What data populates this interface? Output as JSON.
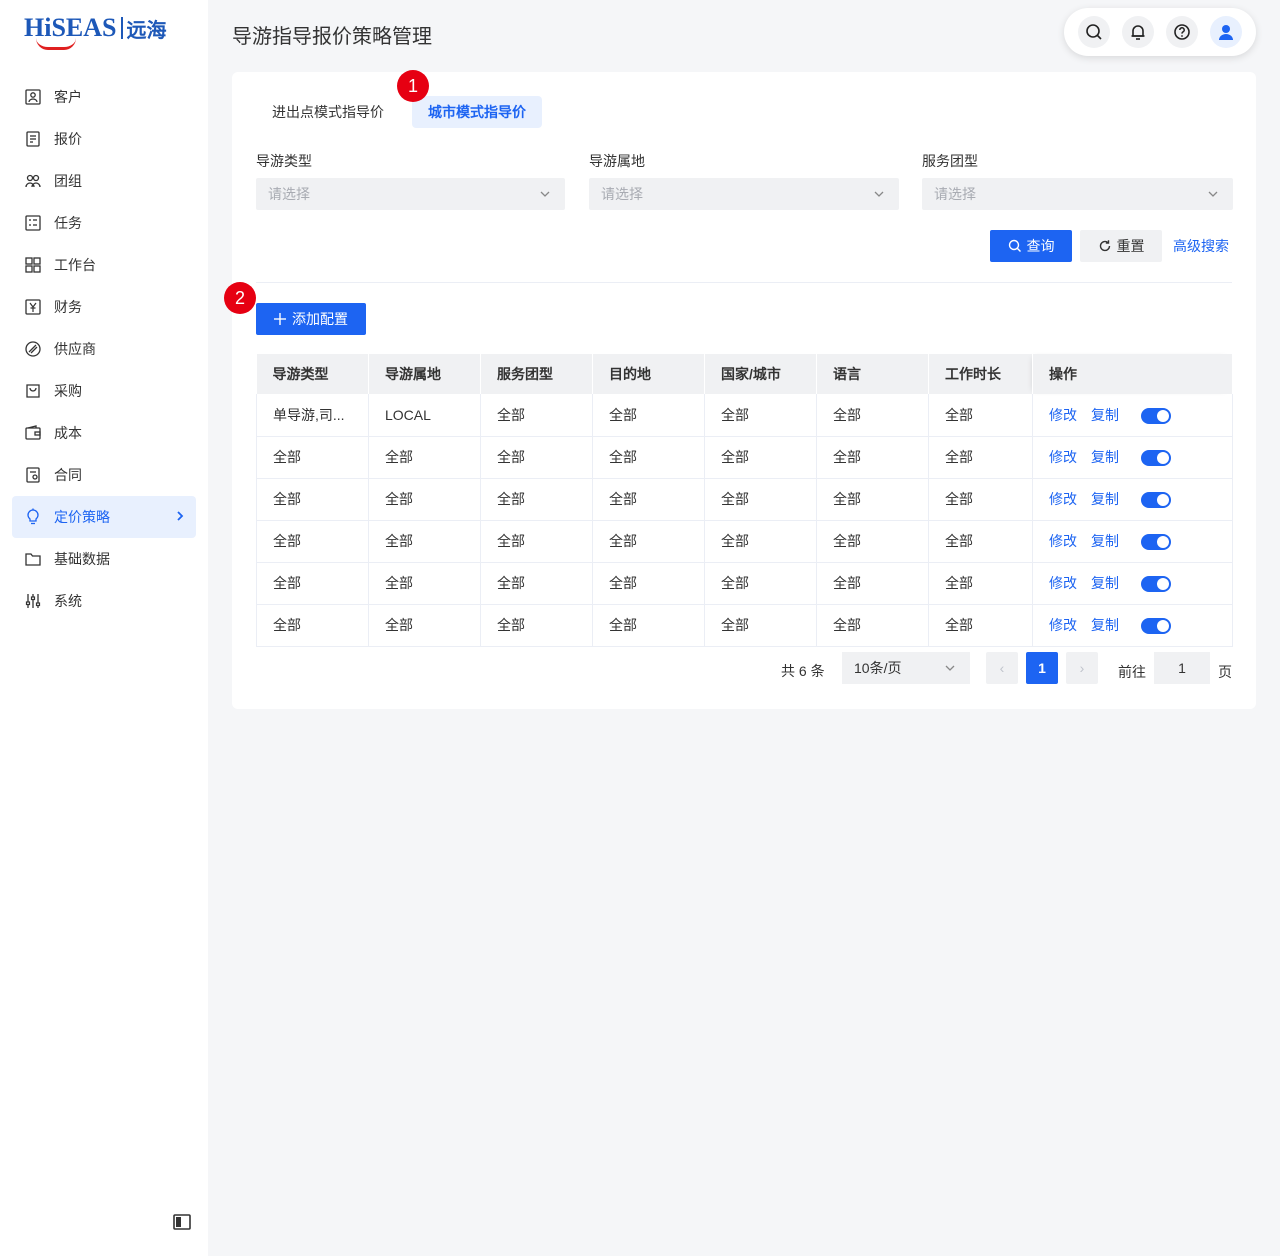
{
  "brand": {
    "name_en": "HiSEAS",
    "name_cn": "远海"
  },
  "colors": {
    "primary": "#1d64f2",
    "badge": "#e60012",
    "active_bg": "#e8f0fe"
  },
  "sidebar": {
    "items": [
      {
        "label": "客户",
        "icon": "customer-icon"
      },
      {
        "label": "报价",
        "icon": "quote-icon"
      },
      {
        "label": "团组",
        "icon": "group-icon"
      },
      {
        "label": "任务",
        "icon": "task-icon"
      },
      {
        "label": "工作台",
        "icon": "dashboard-icon"
      },
      {
        "label": "财务",
        "icon": "finance-icon"
      },
      {
        "label": "供应商",
        "icon": "supplier-icon"
      },
      {
        "label": "采购",
        "icon": "purchase-icon"
      },
      {
        "label": "成本",
        "icon": "wallet-icon"
      },
      {
        "label": "合同",
        "icon": "contract-icon"
      },
      {
        "label": "定价策略",
        "icon": "bulb-icon",
        "active": true
      },
      {
        "label": "基础数据",
        "icon": "folder-icon"
      },
      {
        "label": "系统",
        "icon": "sliders-icon"
      }
    ]
  },
  "header": {
    "title": "导游指导报价策略管理"
  },
  "tabs": [
    {
      "label": "进出点模式指导价",
      "active": false
    },
    {
      "label": "城市模式指导价",
      "active": true
    }
  ],
  "badges": {
    "one": "1",
    "two": "2"
  },
  "filters": [
    {
      "label": "导游类型",
      "placeholder": "请选择"
    },
    {
      "label": "导游属地",
      "placeholder": "请选择"
    },
    {
      "label": "服务团型",
      "placeholder": "请选择"
    }
  ],
  "actions": {
    "query": "查询",
    "reset": "重置",
    "advanced": "高级搜索",
    "add": "添加配置"
  },
  "table": {
    "columns": [
      "导游类型",
      "导游属地",
      "服务团型",
      "目的地",
      "国家/城市",
      "语言",
      "工作时长",
      "操作"
    ],
    "rows": [
      [
        "单导游,司...",
        "LOCAL",
        "全部",
        "全部",
        "全部",
        "全部",
        "全部"
      ],
      [
        "全部",
        "全部",
        "全部",
        "全部",
        "全部",
        "全部",
        "全部"
      ],
      [
        "全部",
        "全部",
        "全部",
        "全部",
        "全部",
        "全部",
        "全部"
      ],
      [
        "全部",
        "全部",
        "全部",
        "全部",
        "全部",
        "全部",
        "全部"
      ],
      [
        "全部",
        "全部",
        "全部",
        "全部",
        "全部",
        "全部",
        "全部"
      ],
      [
        "全部",
        "全部",
        "全部",
        "全部",
        "全部",
        "全部",
        "全部"
      ]
    ],
    "row_actions": {
      "edit": "修改",
      "copy": "复制"
    },
    "toggles_on": [
      true,
      true,
      true,
      true,
      true,
      true
    ]
  },
  "pagination": {
    "total": "共 6 条",
    "page_size": "10条/页",
    "current": "1",
    "goto_label": "前往",
    "goto_value": "1",
    "page_unit": "页",
    "prev": "‹",
    "next": "›"
  }
}
